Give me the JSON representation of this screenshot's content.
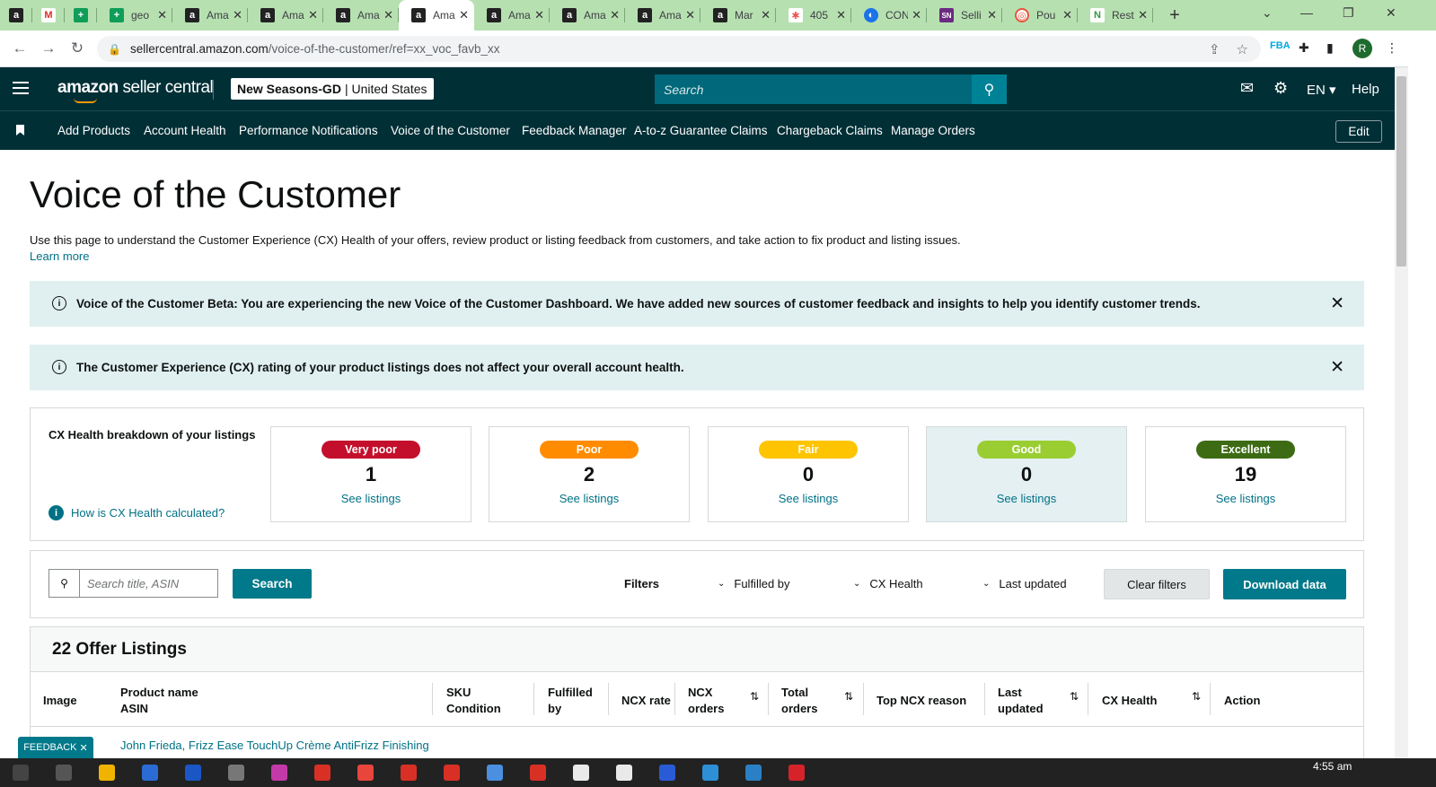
{
  "browser": {
    "tabs": [
      {
        "favicon": "amazon-icon",
        "glyph": "a",
        "label": "",
        "pinned": true
      },
      {
        "favicon": "gmail-icon",
        "glyph": "M",
        "label": "",
        "pinned": true
      },
      {
        "favicon": "sheets-icon",
        "glyph": "+",
        "label": "",
        "pinned": true
      },
      {
        "favicon": "sheets-icon",
        "glyph": "+",
        "label": "geo"
      },
      {
        "favicon": "amazon-icon",
        "glyph": "a",
        "label": "Ama"
      },
      {
        "favicon": "amazon-icon",
        "glyph": "a",
        "label": "Ama"
      },
      {
        "favicon": "amazon-icon",
        "glyph": "a",
        "label": "Ama"
      },
      {
        "favicon": "amazon-icon",
        "glyph": "a",
        "label": "Ama",
        "active": true
      },
      {
        "favicon": "amazon-icon",
        "glyph": "a",
        "label": "Ama"
      },
      {
        "favicon": "amazon-icon",
        "glyph": "a",
        "label": "Ama"
      },
      {
        "favicon": "amazon-icon",
        "glyph": "a",
        "label": "Ama"
      },
      {
        "favicon": "amazon-icon",
        "glyph": "a",
        "label": "Mar"
      },
      {
        "favicon": "multicolor-icon",
        "glyph": "✱",
        "label": "405"
      },
      {
        "favicon": "globe-icon",
        "glyph": "◐",
        "label": "CON"
      },
      {
        "favicon": "sn-icon",
        "glyph": "SN",
        "label": "Selli"
      },
      {
        "favicon": "target-icon",
        "glyph": "◎",
        "label": "Pou"
      },
      {
        "favicon": "leaf-icon",
        "glyph": "N",
        "label": "Rest"
      }
    ],
    "url_host": "sellercentral.amazon.com",
    "url_path": "/voice-of-the-customer/ref=xx_voc_favb_xx",
    "profile_initial": "R"
  },
  "header": {
    "logo_main": "amazon",
    "logo_sub": "seller central",
    "store_name": "New Seasons-GD",
    "marketplace": "United States",
    "search_placeholder": "Search",
    "language": "EN",
    "help": "Help"
  },
  "nav": {
    "links": [
      "Add Products",
      "Account Health",
      "Performance Notifications",
      "Voice of the Customer",
      "Feedback Manager",
      "A-to-z Guarantee Claims",
      "Chargeback Claims",
      "Manage Orders"
    ],
    "edit": "Edit"
  },
  "main": {
    "title": "Voice of the Customer",
    "description": "Use this page to understand the Customer Experience (CX) Health of your offers, review product or listing feedback from customers, and take action to fix product and listing issues.",
    "learn_more": "Learn more",
    "alerts": [
      "Voice of the Customer Beta: You are experiencing the new Voice of the Customer Dashboard. We have added new sources of customer feedback and insights to help you identify customer trends.",
      "The Customer Experience (CX) rating of your product listings does not affect your overall account health."
    ]
  },
  "cx": {
    "title": "CX Health breakdown of your listings",
    "help_link": "How is CX Health calculated?",
    "cards": [
      {
        "label": "Very poor",
        "count": "1",
        "link": "See listings",
        "color": "#c40f2c",
        "text_color": "#ffffff"
      },
      {
        "label": "Poor",
        "count": "2",
        "link": "See listings",
        "color": "#ff8c00",
        "text_color": "#ffffff"
      },
      {
        "label": "Fair",
        "count": "0",
        "link": "See listings",
        "color": "#ffc400",
        "text_color": "#ffffff"
      },
      {
        "label": "Good",
        "count": "0",
        "link": "See listings",
        "color": "#9acd32",
        "text_color": "#ffffff",
        "selected": true
      },
      {
        "label": "Excellent",
        "count": "19",
        "link": "See listings",
        "color": "#3d6b14",
        "text_color": "#ffffff"
      }
    ]
  },
  "filters": {
    "search_placeholder": "Search title, ASIN",
    "search_button": "Search",
    "label": "Filters",
    "dropdowns": [
      "Fulfilled by",
      "CX Health",
      "Last updated"
    ],
    "clear": "Clear filters",
    "download": "Download data"
  },
  "table": {
    "title": "22 Offer Listings",
    "columns": [
      {
        "l1": "Image",
        "l2": ""
      },
      {
        "l1": "Product name",
        "l2": "ASIN"
      },
      {
        "l1": "SKU",
        "l2": "Condition"
      },
      {
        "l1": "Fulfilled",
        "l2": "by"
      },
      {
        "l1": "NCX rate",
        "l2": ""
      },
      {
        "l1": "NCX",
        "l2": "orders"
      },
      {
        "l1": "Total",
        "l2": "orders"
      },
      {
        "l1": "Top NCX reason",
        "l2": ""
      },
      {
        "l1": "Last",
        "l2": "updated"
      },
      {
        "l1": "CX Health",
        "l2": ""
      },
      {
        "l1": "Action",
        "l2": ""
      }
    ],
    "first_row_product": "John Frieda, Frizz Ease TouchUp Crème AntiFrizz Finishing"
  },
  "feedback": "FEEDBACK",
  "taskbar": {
    "time": "4:55 am"
  }
}
